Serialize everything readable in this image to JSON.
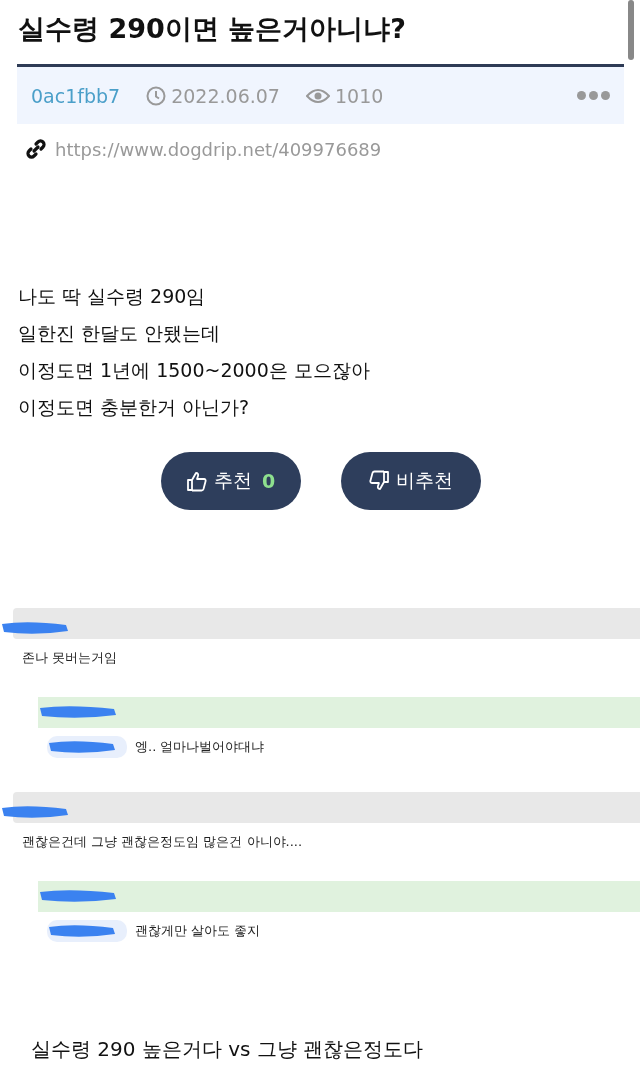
{
  "post": {
    "title": "실수령 290이면 높은거아니냐?",
    "author": "0ac1fbb7",
    "date": "2022.06.07",
    "views": "1010",
    "url": "https://www.dogdrip.net/409976689",
    "body": [
      "나도 딱 실수령 290임",
      "일한진 한달도 안됐는데",
      "이정도면 1년에 1500~2000은 모으잖아",
      "이정도면 충분한거 아닌가?"
    ],
    "votes": [
      {
        "kind": "up",
        "label": "추천",
        "count": "0"
      },
      {
        "kind": "down",
        "label": "비추천"
      }
    ]
  },
  "comments": [
    {
      "text": "존나 못버는거임",
      "children": [
        {
          "text": "엥.. 얼마나벌어야대냐"
        }
      ]
    },
    {
      "text": "괜찮은건데 그냥 괜찮은정도임 많은건 아니야....",
      "children": [
        {
          "text": "괜찮게만 살아도 좋지"
        }
      ]
    }
  ],
  "caption": "실수령 290 높은거다 vs 그냥 괜찮은정도다"
}
